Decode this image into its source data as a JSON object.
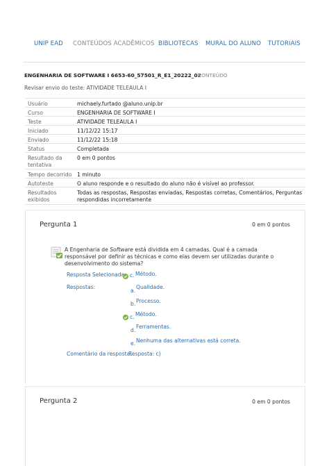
{
  "nav": {
    "items": [
      "UNIP EAD",
      "CONTEÚDOS ACADÊMICOS",
      "BIBLIOTECAS",
      "MURAL DO ALUNO",
      "TUTORIAIS"
    ]
  },
  "breadcrumb": {
    "course": "ENGENHARIA DE SOFTWARE I 6653-60_57501_R_E1_20222_02",
    "section": "CONTEÚDO"
  },
  "subtitle": "Revisar envio do teste: ATIVIDADE TELEAULA I",
  "info": [
    {
      "label": "Usuário",
      "value": "michaely.furtado @aluno.unip.br"
    },
    {
      "label": "Curso",
      "value": "ENGENHARIA DE SOFTWARE I"
    },
    {
      "label": "Teste",
      "value": "ATIVIDADE TELEAULA I"
    },
    {
      "label": "Iniciado",
      "value": "11/12/22 15:17"
    },
    {
      "label": "Enviado",
      "value": "11/12/22 15:18"
    },
    {
      "label": "Status",
      "value": "Completada"
    },
    {
      "label": "Resultado da tentativa",
      "value": "0 em 0 pontos"
    },
    {
      "label": "Tempo decorrido",
      "value": "1 minuto"
    },
    {
      "label": "Autoteste",
      "value": "O aluno responde e o resultado do aluno não é visível ao professor."
    },
    {
      "label": "Resultados exibidos",
      "value": "Todas as respostas, Respostas enviadas, Respostas corretas, Comentários, Perguntas respondidas incorretamente"
    }
  ],
  "question1": {
    "title": "Pergunta 1",
    "score": "0 em 0 pontos",
    "text_before": "A Engenharia de ",
    "text_italic": "Software",
    "text_after": " está dividida em 4 camadas. Qual é a camada responsável por definir as técnicas e como elas devem ser utilizadas durante o desenvolvimento do sistema?",
    "selected_label": "Resposta Selecionada:",
    "selected_letter": "c.",
    "selected_text": "Método.",
    "answers_label": "Respostas:",
    "options": [
      {
        "letter": "a.",
        "text": "Qualidade."
      },
      {
        "letter": "b.",
        "text": "Processo."
      },
      {
        "letter": "c.",
        "text": "Método."
      },
      {
        "letter": "d.",
        "text": "Ferramentas."
      },
      {
        "letter": "e.",
        "text": "Nenhuma das alternativas está correta."
      }
    ],
    "comment_label": "Comentário da resposta:",
    "comment_text": "Resposta: c)"
  },
  "question2": {
    "title": "Pergunta 2",
    "score": "0 em 0 pontos"
  },
  "colors": {
    "link_blue": "#2f6ba8",
    "check_green": "#7cb342"
  }
}
